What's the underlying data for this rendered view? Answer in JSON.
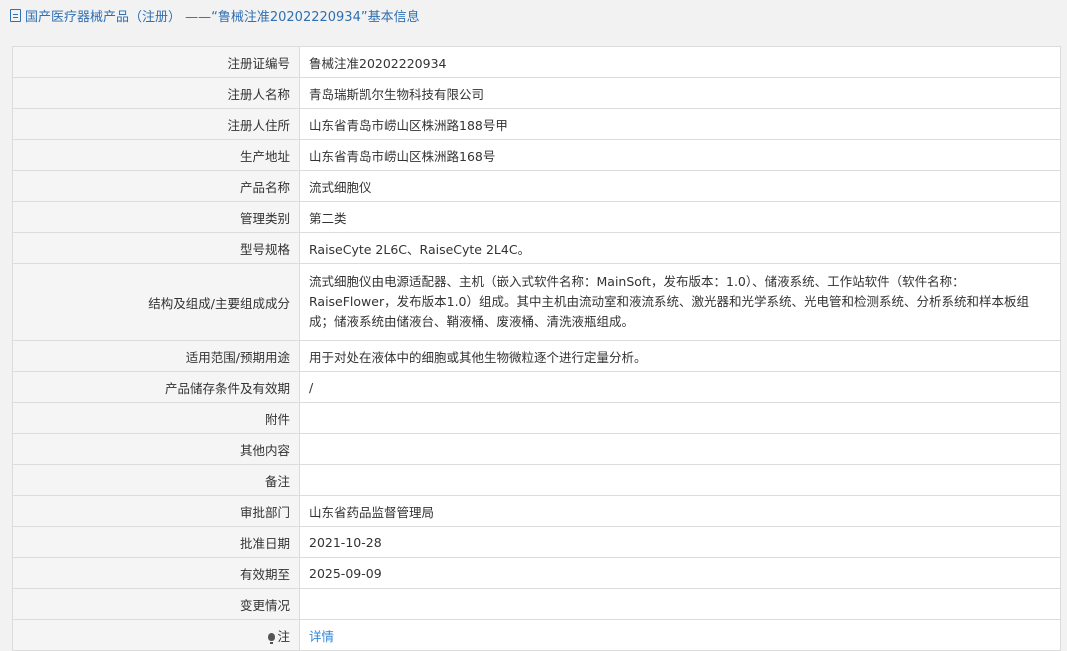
{
  "header": {
    "title": "国产医疗器械产品（注册） ——“鲁械注准20202220934”基本信息"
  },
  "rows": [
    {
      "label": "注册证编号",
      "value": "鲁械注准20202220934"
    },
    {
      "label": "注册人名称",
      "value": "青岛瑞斯凯尔生物科技有限公司"
    },
    {
      "label": "注册人住所",
      "value": "山东省青岛市崂山区株洲路188号甲"
    },
    {
      "label": "生产地址",
      "value": "山东省青岛市崂山区株洲路168号"
    },
    {
      "label": "产品名称",
      "value": "流式细胞仪"
    },
    {
      "label": "管理类别",
      "value": "第二类"
    },
    {
      "label": "型号规格",
      "value": "RaiseCyte 2L6C、RaiseCyte 2L4C。"
    },
    {
      "label": "结构及组成/主要组成成分",
      "value": "流式细胞仪由电源适配器、主机（嵌入式软件名称：MainSoft，发布版本：1.0）、储液系统、工作站软件（软件名称：RaiseFlower，发布版本1.0）组成。其中主机由流动室和液流系统、激光器和光学系统、光电管和检测系统、分析系统和样本板组成；储液系统由储液台、鞘液桶、废液桶、清洗液瓶组成。"
    },
    {
      "label": "适用范围/预期用途",
      "value": "用于对处在液体中的细胞或其他生物微粒逐个进行定量分析。"
    },
    {
      "label": "产品储存条件及有效期",
      "value": "/"
    },
    {
      "label": "附件",
      "value": ""
    },
    {
      "label": "其他内容",
      "value": ""
    },
    {
      "label": "备注",
      "value": ""
    },
    {
      "label": "审批部门",
      "value": "山东省药品监督管理局"
    },
    {
      "label": "批准日期",
      "value": "2021-10-28"
    },
    {
      "label": "有效期至",
      "value": "2025-09-09"
    },
    {
      "label": "变更情况",
      "value": ""
    },
    {
      "label": "注",
      "value": "详情"
    }
  ]
}
